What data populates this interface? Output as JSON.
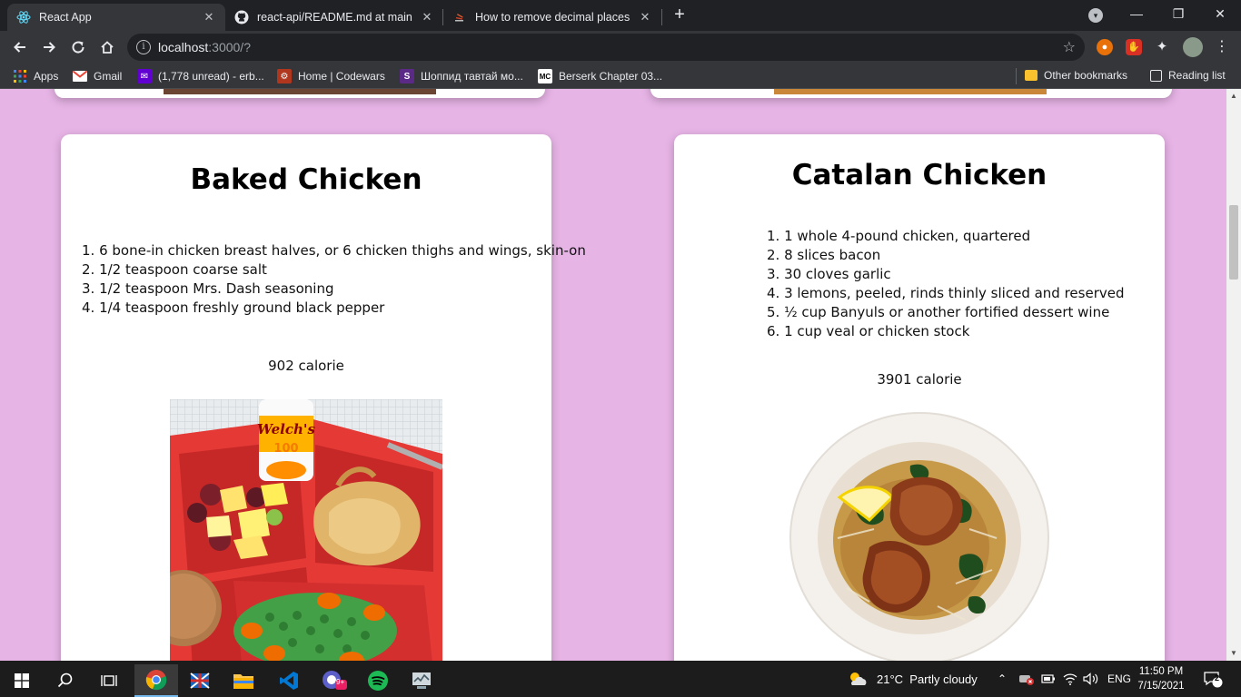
{
  "browser": {
    "tabs": [
      {
        "title": "React App",
        "icon": "react-icon",
        "active": true
      },
      {
        "title": "react-api/README.md at main · E",
        "icon": "github-icon",
        "active": false
      },
      {
        "title": "How to remove decimal places in",
        "icon": "stackoverflow-icon",
        "active": false
      }
    ],
    "close_glyph": "✕",
    "new_tab_glyph": "+",
    "url_host": "localhost",
    "url_rest": ":3000/?",
    "bookmarks": [
      {
        "label": "Apps",
        "icon": "apps-grid-icon"
      },
      {
        "label": "Gmail",
        "icon": "gmail-icon"
      },
      {
        "label": "(1,778 unread) - erb...",
        "icon": "yahoo-mail-icon"
      },
      {
        "label": "Home | Codewars",
        "icon": "codewars-icon"
      },
      {
        "label": "Шоппид тавтай мо...",
        "icon": "shoppy-icon"
      },
      {
        "label": "Berserk Chapter 03...",
        "icon": "manga-icon"
      }
    ],
    "other_bookmarks": "Other bookmarks",
    "reading_list": "Reading list",
    "colors": {
      "tab_bar": "#202124",
      "toolbar": "#35363a",
      "page_bg": "#e7b4e6"
    }
  },
  "recipes": [
    {
      "title": "Baked Chicken",
      "ingredients": [
        "1. 6 bone-in chicken breast halves, or 6 chicken thighs and wings, skin-on",
        "2. 1/2 teaspoon coarse salt",
        "3. 1/2 teaspoon Mrs. Dash seasoning",
        "4. 1/4 teaspoon freshly ground black pepper"
      ],
      "calories": "902 calorie",
      "can_label": "Welch's",
      "can_sub": "100"
    },
    {
      "title": "Catalan Chicken",
      "ingredients": [
        "1. 1 whole 4-pound chicken, quartered",
        "2. 8 slices bacon",
        "3. 30 cloves garlic",
        "4. 3 lemons, peeled, rinds thinly sliced and reserved",
        "5. ½ cup Banyuls or another fortified dessert wine",
        "6. 1 cup veal or chicken stock"
      ],
      "calories": "3901 calorie"
    }
  ],
  "taskbar": {
    "weather": "21°C  Partly cloudy",
    "language": "ENG",
    "time": "11:50 PM",
    "date": "7/15/2021",
    "notifications": "2",
    "badge": "9+"
  }
}
